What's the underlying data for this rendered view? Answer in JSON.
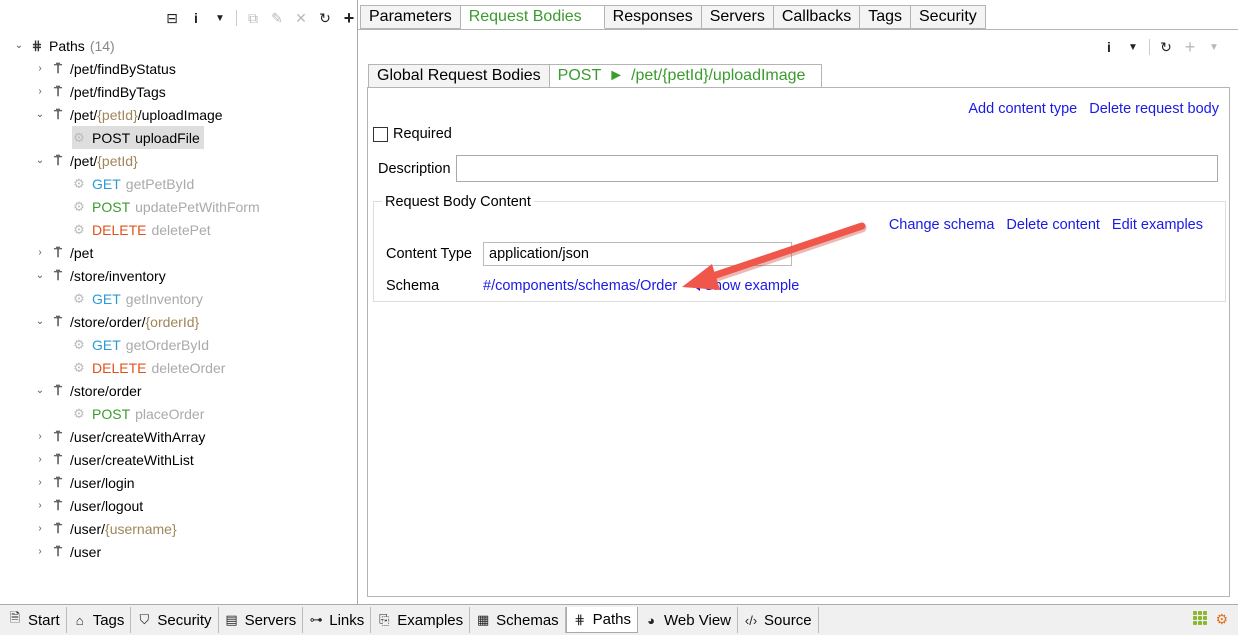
{
  "left_toolbar": {
    "icons": [
      "collapse-all-icon",
      "info-icon",
      "dropdown-icon",
      "copy-icon",
      "edit-icon",
      "delete-icon",
      "refresh-icon",
      "add-icon"
    ]
  },
  "tree": {
    "root_label": "Paths",
    "root_count": "(14)",
    "rows": [
      {
        "kind": "path",
        "twisty": "›",
        "segments": [
          {
            "text": "/pet/findByStatus",
            "param": false
          }
        ]
      },
      {
        "kind": "path",
        "twisty": "›",
        "segments": [
          {
            "text": "/pet/findByTags",
            "param": false
          }
        ]
      },
      {
        "kind": "path",
        "twisty": "⌄",
        "segments": [
          {
            "text": "/pet/",
            "param": false
          },
          {
            "text": "{petId}",
            "param": true
          },
          {
            "text": "/uploadImage",
            "param": false
          }
        ]
      },
      {
        "kind": "op",
        "method": "POST",
        "opid": "uploadFile",
        "selected": true
      },
      {
        "kind": "path",
        "twisty": "⌄",
        "segments": [
          {
            "text": "/pet/",
            "param": false
          },
          {
            "text": "{petId}",
            "param": true
          }
        ]
      },
      {
        "kind": "op",
        "method": "GET",
        "opid": "getPetById"
      },
      {
        "kind": "op",
        "method": "POST",
        "opid": "updatePetWithForm"
      },
      {
        "kind": "op",
        "method": "DELETE",
        "opid": "deletePet"
      },
      {
        "kind": "path",
        "twisty": "›",
        "segments": [
          {
            "text": "/pet",
            "param": false
          }
        ]
      },
      {
        "kind": "path",
        "twisty": "⌄",
        "segments": [
          {
            "text": "/store/inventory",
            "param": false
          }
        ]
      },
      {
        "kind": "op",
        "method": "GET",
        "opid": "getInventory"
      },
      {
        "kind": "path",
        "twisty": "⌄",
        "segments": [
          {
            "text": "/store/order/",
            "param": false
          },
          {
            "text": "{orderId}",
            "param": true
          }
        ]
      },
      {
        "kind": "op",
        "method": "GET",
        "opid": "getOrderById"
      },
      {
        "kind": "op",
        "method": "DELETE",
        "opid": "deleteOrder"
      },
      {
        "kind": "path",
        "twisty": "⌄",
        "segments": [
          {
            "text": "/store/order",
            "param": false
          }
        ]
      },
      {
        "kind": "op",
        "method": "POST",
        "opid": "placeOrder"
      },
      {
        "kind": "path",
        "twisty": "›",
        "segments": [
          {
            "text": "/user/createWithArray",
            "param": false
          }
        ]
      },
      {
        "kind": "path",
        "twisty": "›",
        "segments": [
          {
            "text": "/user/createWithList",
            "param": false
          }
        ]
      },
      {
        "kind": "path",
        "twisty": "›",
        "segments": [
          {
            "text": "/user/login",
            "param": false
          }
        ]
      },
      {
        "kind": "path",
        "twisty": "›",
        "segments": [
          {
            "text": "/user/logout",
            "param": false
          }
        ]
      },
      {
        "kind": "path",
        "twisty": "›",
        "segments": [
          {
            "text": "/user/",
            "param": false
          },
          {
            "text": "{username}",
            "param": true
          }
        ]
      },
      {
        "kind": "path",
        "twisty": "›",
        "segments": [
          {
            "text": "/user",
            "param": false
          }
        ]
      }
    ]
  },
  "top_tabs": [
    {
      "label": "Parameters",
      "active": false
    },
    {
      "label": "Request Bodies",
      "active": true
    },
    {
      "label": "Responses",
      "active": false
    },
    {
      "label": "Servers",
      "active": false
    },
    {
      "label": "Callbacks",
      "active": false
    },
    {
      "label": "Tags",
      "active": false
    },
    {
      "label": "Security",
      "active": false
    }
  ],
  "sub_tabs": {
    "global_label": "Global Request Bodies",
    "active_method": "POST",
    "active_arrow": "►",
    "active_path": "/pet/{petId}/uploadImage"
  },
  "editor": {
    "add_content_type": "Add content type",
    "delete_request_body": "Delete request body",
    "required_label": "Required",
    "description_label": "Description",
    "description_value": "",
    "group_title": "Request Body Content",
    "change_schema": "Change schema",
    "delete_content": "Delete content",
    "edit_examples": "Edit examples",
    "content_type_label": "Content Type",
    "content_type_value": "application/json",
    "schema_label": "Schema",
    "schema_value": "#/components/schemas/Order",
    "show_example": "Show example"
  },
  "bottom_tabs": [
    {
      "label": "Start",
      "icon": "document-icon",
      "glyph": "🗎",
      "active": false
    },
    {
      "label": "Tags",
      "icon": "tag-icon",
      "glyph": "⌂",
      "active": false
    },
    {
      "label": "Security",
      "icon": "shield-icon",
      "glyph": "⛉",
      "active": false
    },
    {
      "label": "Servers",
      "icon": "server-icon",
      "glyph": "▤",
      "active": false
    },
    {
      "label": "Links",
      "icon": "link-icon",
      "glyph": "⊶",
      "active": false
    },
    {
      "label": "Examples",
      "icon": "examples-icon",
      "glyph": "⎘",
      "active": false
    },
    {
      "label": "Schemas",
      "icon": "schemas-icon",
      "glyph": "▦",
      "active": false
    },
    {
      "label": "Paths",
      "icon": "paths-icon",
      "glyph": "⋕",
      "active": true
    },
    {
      "label": "Web View",
      "icon": "globe-icon",
      "glyph": "◕",
      "active": false
    },
    {
      "label": "Source",
      "icon": "code-icon",
      "glyph": "‹/›",
      "active": false
    }
  ],
  "colors": {
    "accent_green": "#3a9b2e",
    "get_blue": "#2a9bd6",
    "delete_orange": "#e0521c",
    "link_blue": "#1a1ae6",
    "annotation_arrow": "#f0564a"
  }
}
